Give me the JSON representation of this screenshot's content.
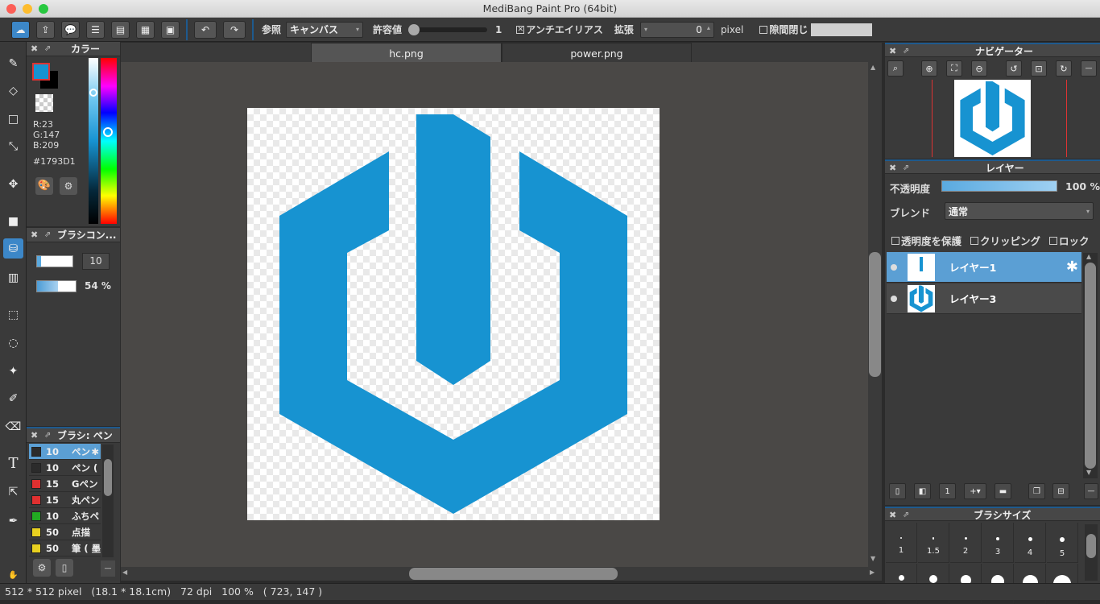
{
  "window": {
    "title": "MediBang Paint Pro (64bit)"
  },
  "toolbar": {
    "ref_label": "参照",
    "ref_value": "キャンバス",
    "tolerance_label": "許容値",
    "tolerance_value": "1",
    "antialias_label": "アンチエイリアス",
    "antialias_checked": true,
    "expand_label": "拡張",
    "expand_value": "0",
    "expand_unit": "pixel",
    "gap_label": "隙間閉じ",
    "gap_checked": false
  },
  "tabs": [
    {
      "label": "hc.png",
      "active": true
    },
    {
      "label": "power.png",
      "active": false
    }
  ],
  "color_panel": {
    "title": "カラー",
    "r": "R:23",
    "g": "G:147",
    "b": "B:209",
    "hex": "#1793D1",
    "primary": "#1793D1"
  },
  "brush_control": {
    "title": "ブラシコン...",
    "size": "10",
    "opacity": "54 %",
    "opacity_value": 0.54
  },
  "brush_panel": {
    "title": "ブラシ: ペン",
    "items": [
      {
        "size": "10",
        "name": "ペン",
        "color": "#2b2b2b",
        "selected": true
      },
      {
        "size": "10",
        "name": "ペン (",
        "color": "#2b2b2b",
        "selected": false
      },
      {
        "size": "15",
        "name": "Gペン",
        "color": "#e03030",
        "selected": false
      },
      {
        "size": "15",
        "name": "丸ペン",
        "color": "#e03030",
        "selected": false
      },
      {
        "size": "10",
        "name": "ふちペ",
        "color": "#22aa22",
        "selected": false
      },
      {
        "size": "50",
        "name": "点描",
        "color": "#e8d020",
        "selected": false
      },
      {
        "size": "50",
        "name": "筆 ( 墨",
        "color": "#e8d020",
        "selected": false
      }
    ]
  },
  "navigator": {
    "title": "ナビゲーター"
  },
  "layer_panel": {
    "title": "レイヤー",
    "opacity_label": "不透明度",
    "opacity_value": "100 %",
    "opacity_fraction": 1.0,
    "blend_label": "ブレンド",
    "blend_value": "通常",
    "protect_label": "透明度を保護",
    "clipping_label": "クリッピング",
    "lock_label": "ロック",
    "layers": [
      {
        "name": "レイヤー1",
        "selected": true
      },
      {
        "name": "レイヤー3",
        "selected": false
      }
    ]
  },
  "brush_size_panel": {
    "title": "ブラシサイズ",
    "sizes": [
      "1",
      "1.5",
      "2",
      "3",
      "4",
      "5"
    ]
  },
  "status": {
    "dims": "512 * 512 pixel",
    "physical": "(18.1 * 18.1cm)",
    "dpi": "72 dpi",
    "zoom": "100 %",
    "cursor": "( 723, 147 )"
  },
  "colors": {
    "accent": "#1793D1",
    "selection": "#5b9fd4"
  }
}
